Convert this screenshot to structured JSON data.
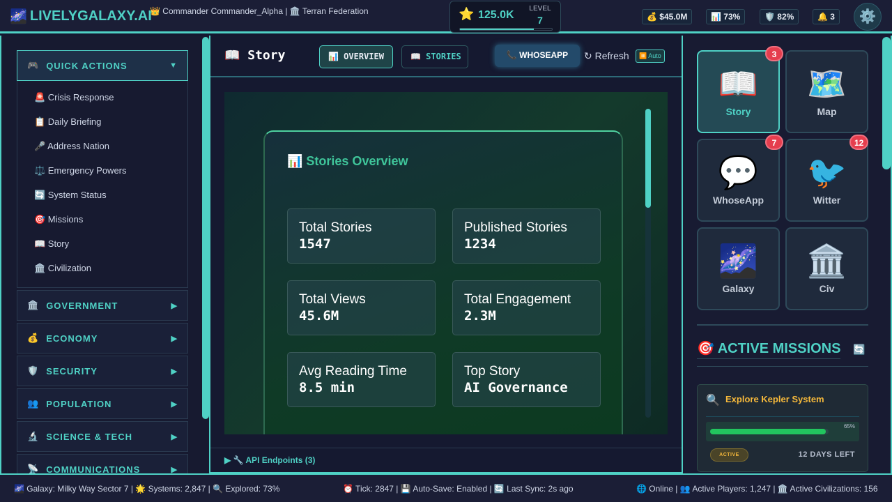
{
  "header": {
    "logo_icon": "🌌",
    "logo": "LIVELYGALAXY.AI",
    "commander": "👑 Commander Commander_Alpha | 🏛️ Terran Federation",
    "xp": {
      "icon": "⭐",
      "value": "125.0K",
      "level_label": "LEVEL",
      "level": "7",
      "progress_pct": 80
    },
    "stats": [
      {
        "icon": "💰",
        "value": "$45.0M"
      },
      {
        "icon": "📊",
        "value": "73%"
      },
      {
        "icon": "🛡️",
        "value": "82%"
      },
      {
        "icon": "🔔",
        "value": "3"
      }
    ],
    "settings_icon": "⚙️"
  },
  "sidebar": {
    "quick_actions": {
      "icon": "🎮",
      "label": "QUICK ACTIONS",
      "arrow": "▼"
    },
    "quick_items": [
      "🚨 Crisis Response",
      "📋 Daily Briefing",
      "🎤 Address Nation",
      "⚖️ Emergency Powers",
      "🔄 System Status",
      "🎯 Missions",
      "📖 Story",
      "🏛️ Civilization"
    ],
    "sections": [
      {
        "icon": "🏛️",
        "label": "GOVERNMENT"
      },
      {
        "icon": "💰",
        "label": "ECONOMY"
      },
      {
        "icon": "🛡️",
        "label": "SECURITY"
      },
      {
        "icon": "👥",
        "label": "POPULATION"
      },
      {
        "icon": "🔬",
        "label": "SCIENCE & TECH"
      },
      {
        "icon": "📡",
        "label": "COMMUNICATIONS"
      }
    ],
    "arrow": "▶"
  },
  "main": {
    "title": "📖 Story",
    "tabs": [
      {
        "label": "📊 OVERVIEW"
      },
      {
        "label": "📖 STORIES"
      }
    ],
    "whoseapp": "📞 WHOSEAPP",
    "refresh": "↻ Refresh",
    "auto": "⏸️ Auto",
    "overview_title": "📊 Stories Overview",
    "stats": [
      {
        "label": "Total Stories",
        "value": "1547"
      },
      {
        "label": "Published Stories",
        "value": "1234"
      },
      {
        "label": "Total Views",
        "value": "45.6M"
      },
      {
        "label": "Total Engagement",
        "value": "2.3M"
      },
      {
        "label": "Avg Reading Time",
        "value": "8.5 min"
      },
      {
        "label": "Top Story",
        "value": "AI Governance"
      }
    ],
    "api": "▶  🔧 API Endpoints (3)"
  },
  "apps": [
    {
      "icon": "📖",
      "name": "Story",
      "badge": "3"
    },
    {
      "icon": "🗺️",
      "name": "Map"
    },
    {
      "icon": "💬",
      "name": "WhoseApp",
      "badge": "7"
    },
    {
      "icon": "🐦",
      "name": "Witter",
      "badge": "12"
    },
    {
      "icon": "🌌",
      "name": "Galaxy"
    },
    {
      "icon": "🏛️",
      "name": "Civ"
    }
  ],
  "missions": {
    "title": "🎯 ACTIVE MISSIONS",
    "refresh_icon": "🔄",
    "items": [
      {
        "icon": "🔍",
        "name": "Explore Kepler System",
        "progress_label": "65%",
        "progress_pct": 65,
        "status": "ACTIVE",
        "time_left": "12 DAYS LEFT"
      }
    ]
  },
  "footer": {
    "left": "🌌 Galaxy: Milky Way Sector 7 | 🌟 Systems: 2,847 | 🔍 Explored: 73%",
    "center": "⏰ Tick: 2847 | 💾 Auto-Save: Enabled | 🔄 Last Sync: 2s ago",
    "right": "🌐 Online | 👥 Active Players: 1,247 | 🏛️ Active Civilizations: 156"
  },
  "colors": {
    "accent": "#4fd1c5",
    "mission": "#f6b93b",
    "badge": "#e53e4e",
    "progress": "#22c55e"
  }
}
